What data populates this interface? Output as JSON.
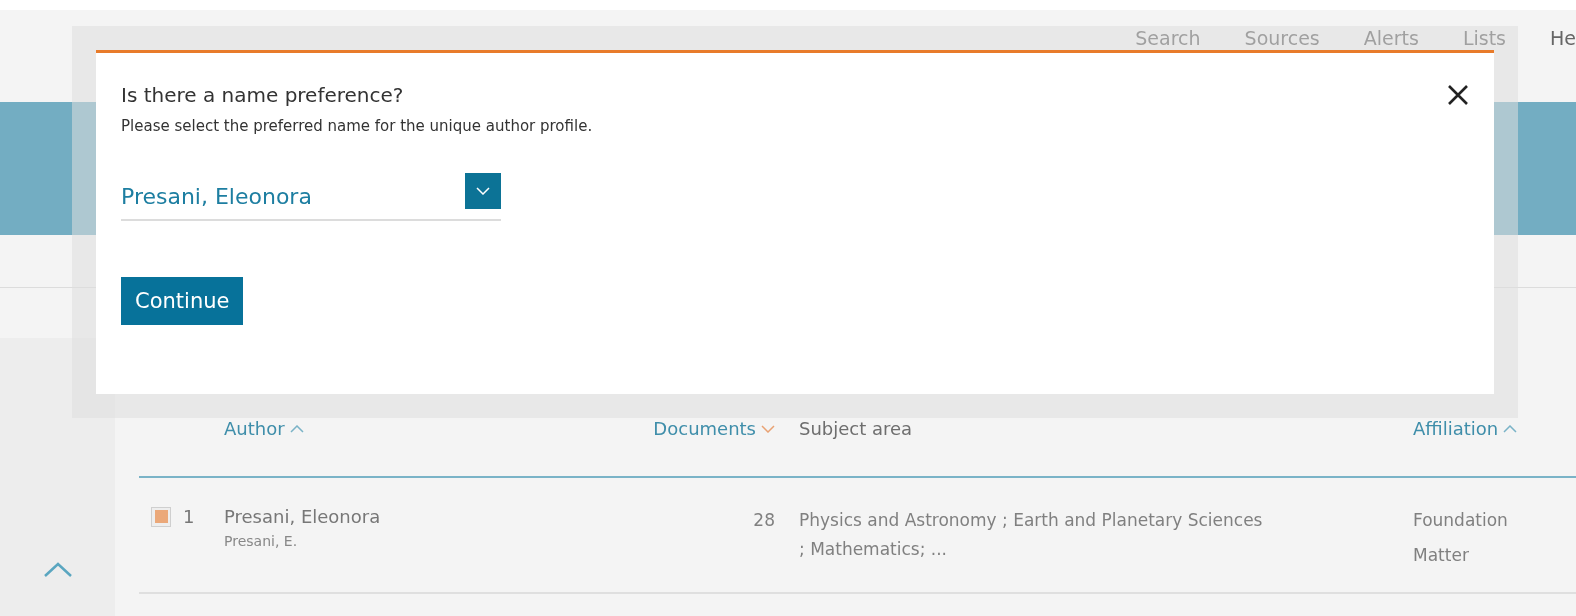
{
  "nav": {
    "items": [
      {
        "label": "Search"
      },
      {
        "label": "Sources"
      },
      {
        "label": "Alerts"
      },
      {
        "label": "Lists"
      },
      {
        "label": "He"
      }
    ]
  },
  "table": {
    "columns": [
      {
        "label": "Author",
        "sortable": true,
        "ascending": true,
        "active": false
      },
      {
        "label": "Documents",
        "sortable": true,
        "ascending": false,
        "active": true
      },
      {
        "label": "Subject area",
        "sortable": false
      },
      {
        "label": "Affiliation",
        "sortable": true,
        "ascending": true,
        "active": false
      }
    ],
    "rows": [
      {
        "checked": true,
        "number": "1",
        "name": "Presani, Eleonora",
        "name_variant": "Presani, E.",
        "documents": "28",
        "subject_area": "Physics and Astronomy ; Earth and Planetary Sciences ; Mathematics; ...",
        "affiliation": [
          "Foundation",
          "Matter"
        ]
      }
    ]
  },
  "dialog": {
    "title": "Is there a name preference?",
    "message": "Please select the preferred name for the unique author profile.",
    "select": {
      "value": "Presani, Eleonora"
    },
    "button": "Continue"
  }
}
